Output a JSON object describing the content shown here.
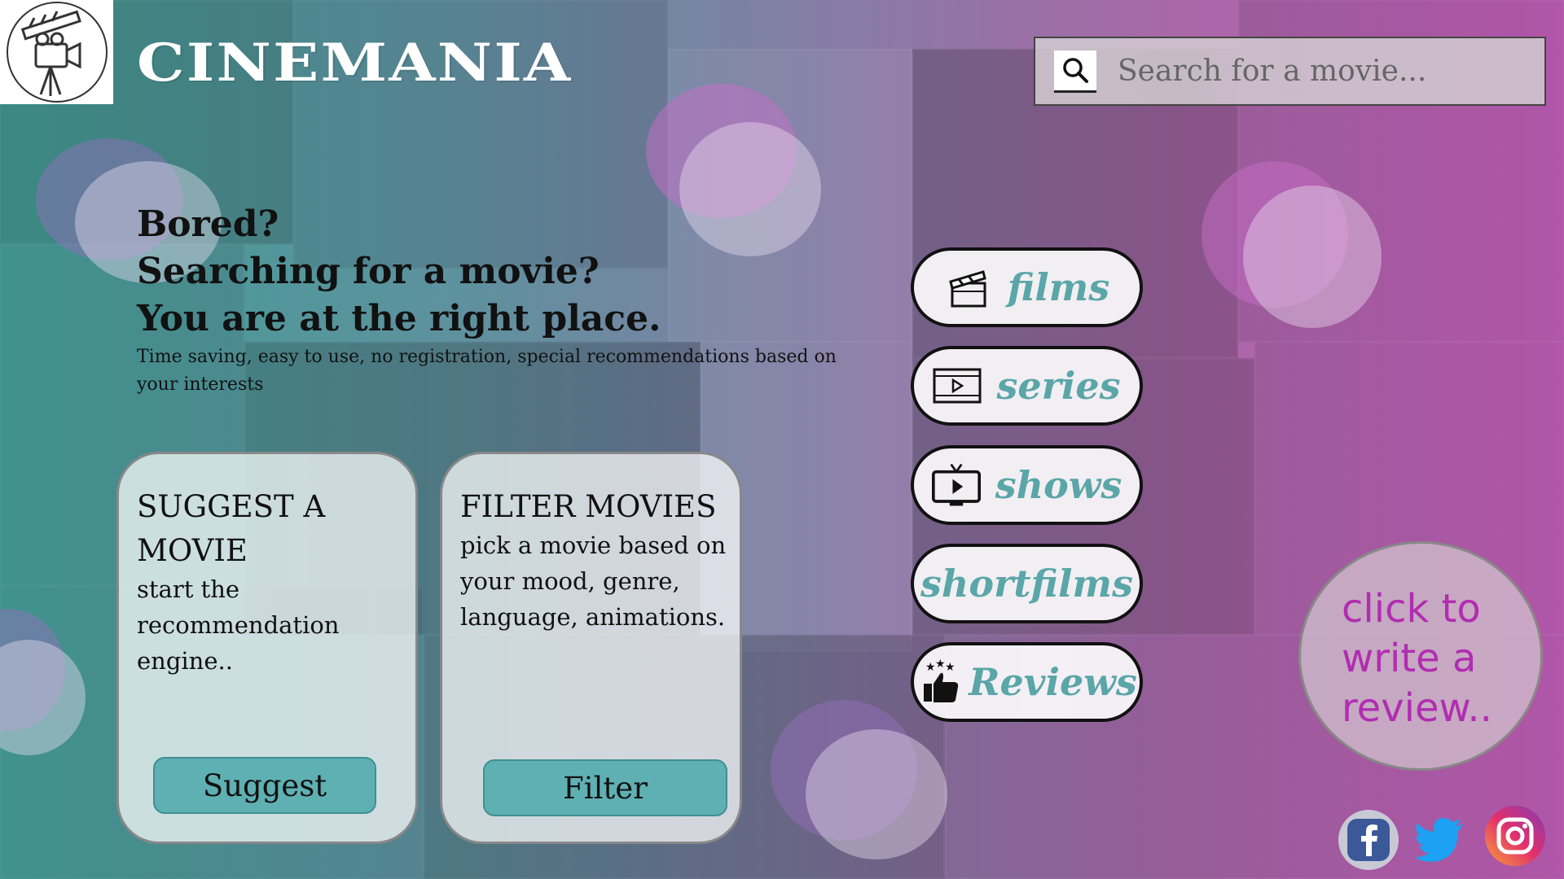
{
  "header": {
    "brand": "CINEMANIA",
    "search": {
      "placeholder": "Search for a movie..."
    }
  },
  "hero": {
    "line1": "Bored?",
    "line2": "Searching for a movie?",
    "line3": "You are at the right place.",
    "subtitle": "Time saving, easy to use, no registration, special recommendations based on your interests"
  },
  "cards": {
    "suggest": {
      "title": "SUGGEST A MOVIE",
      "desc": "start the recommendation engine..",
      "button": "Suggest"
    },
    "filter": {
      "title": "FILTER MOVIES",
      "desc": "pick a movie based on your mood, genre, language, animations.",
      "button": "Filter"
    }
  },
  "nav": [
    {
      "label": "films",
      "icon": "clapperboard-icon"
    },
    {
      "label": "series",
      "icon": "film-strip-play-icon"
    },
    {
      "label": "shows",
      "icon": "tv-play-icon"
    },
    {
      "label": "shortfilms",
      "icon": ""
    },
    {
      "label": "Reviews",
      "icon": "thumbs-up-stars-icon"
    }
  ],
  "review_cta": "click to write a review..",
  "social": [
    {
      "name": "facebook-icon",
      "color": "#3b5998"
    },
    {
      "name": "twitter-icon",
      "color": "#1da1f2"
    },
    {
      "name": "instagram-icon",
      "color": "#e1306c"
    }
  ],
  "colors": {
    "teal": "#5fb0b2",
    "nav_text": "#5aa6a8",
    "review_text": "#b02db0"
  }
}
